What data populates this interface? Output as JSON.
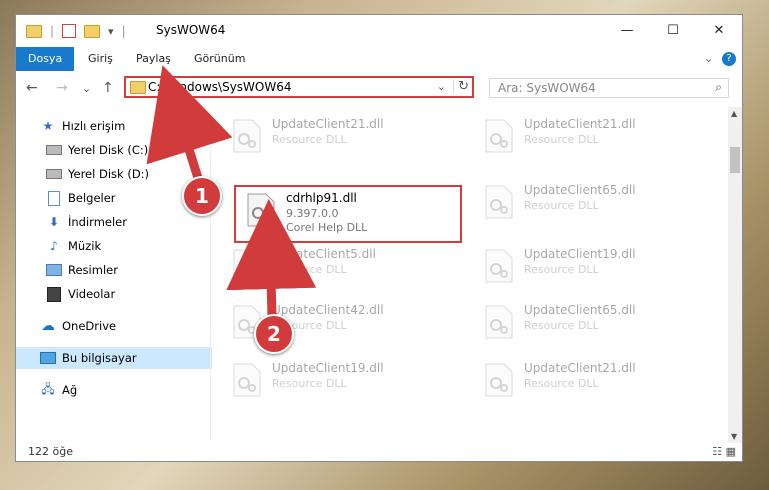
{
  "window": {
    "title": "SysWOW64",
    "minimize": "—",
    "maximize": "☐",
    "close": "✕"
  },
  "ribbon": {
    "tabs": [
      "Dosya",
      "Giriş",
      "Paylaş",
      "Görünüm"
    ],
    "expand": "⌄",
    "help": "?"
  },
  "nav": {
    "back": "←",
    "forward": "→",
    "recent": "⌄",
    "up": "↑",
    "address": "C:\\Windows\\SysWOW64",
    "address_dropdown": "⌄",
    "refresh": "↻",
    "search_placeholder": "Ara: SysWOW64",
    "search_icon": "⌕"
  },
  "sidebar": {
    "items": [
      {
        "label": "Hızlı erişim",
        "icon": "star-icon"
      },
      {
        "label": "Yerel Disk (C:)",
        "icon": "drive-icon",
        "pinned": true
      },
      {
        "label": "Yerel Disk (D:)",
        "icon": "drive-icon",
        "pinned": true
      },
      {
        "label": "Belgeler",
        "icon": "documents-icon",
        "pinned": true
      },
      {
        "label": "İndirmeler",
        "icon": "download-icon",
        "pinned": true
      },
      {
        "label": "Müzik",
        "icon": "music-icon",
        "pinned": true
      },
      {
        "label": "Resimler",
        "icon": "pictures-icon",
        "pinned": true
      },
      {
        "label": "Videolar",
        "icon": "videos-icon",
        "pinned": true
      },
      {
        "label": "OneDrive",
        "icon": "cloud-icon"
      },
      {
        "label": "Bu bilgisayar",
        "icon": "computer-icon",
        "selected": true
      },
      {
        "label": "Ağ",
        "icon": "network-icon"
      }
    ]
  },
  "files": {
    "highlighted": {
      "name": "cdrhlp91.dll",
      "version": "9.397.0.0",
      "description": "Corel Help DLL"
    },
    "left": [
      {
        "name": "UpdateClient21.dll",
        "type": "Resource DLL"
      },
      {
        "name": "UpdateClient5.dll",
        "type": "Resource DLL"
      },
      {
        "name": "UpdateClient42.dll",
        "type": "Resource DLL"
      },
      {
        "name": "UpdateClient19.dll",
        "type": "Resource DLL"
      }
    ],
    "right": [
      {
        "name": "UpdateClient21.dll",
        "type": "Resource DLL"
      },
      {
        "name": "UpdateClient65.dll",
        "type": "Resource DLL"
      },
      {
        "name": "UpdateClient19.dll",
        "type": "Resource DLL"
      },
      {
        "name": "UpdateClient65.dll",
        "type": "Resource DLL"
      },
      {
        "name": "UpdateClient21.dll",
        "type": "Resource DLL"
      }
    ]
  },
  "status": {
    "count": "122 öğe"
  },
  "markers": {
    "one": "1",
    "two": "2"
  },
  "colors": {
    "accent": "#1979ca",
    "highlight": "#d23c3c",
    "selected": "#cce8ff"
  }
}
